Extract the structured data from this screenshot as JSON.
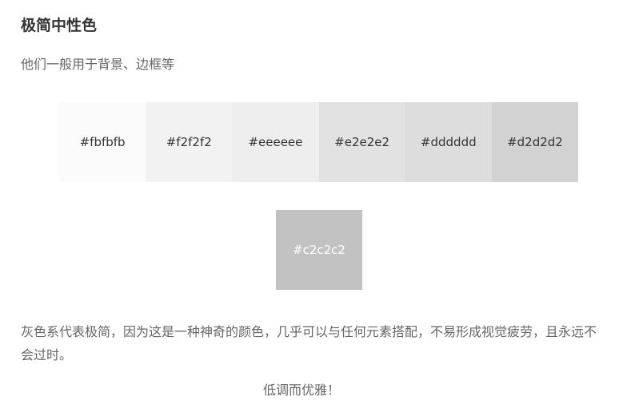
{
  "title": "极简中性色",
  "subtitle": "他们一般用于背景、边框等",
  "swatches": [
    {
      "label": "#fbfbfb",
      "color": "#fbfbfb"
    },
    {
      "label": "#f2f2f2",
      "color": "#f2f2f2"
    },
    {
      "label": "#eeeeee",
      "color": "#eeeeee"
    },
    {
      "label": "#e2e2e2",
      "color": "#e2e2e2"
    },
    {
      "label": "#dddddd",
      "color": "#dddddd"
    },
    {
      "label": "#d2d2d2",
      "color": "#d2d2d2"
    }
  ],
  "swatch_single": {
    "label": "#c2c2c2",
    "color": "#c2c2c2"
  },
  "description": "灰色系代表极简，因为这是一种神奇的颜色，几乎可以与任何元素搭配，不易形成视觉疲劳，且永远不会过时。",
  "footer": "低调而优雅！"
}
